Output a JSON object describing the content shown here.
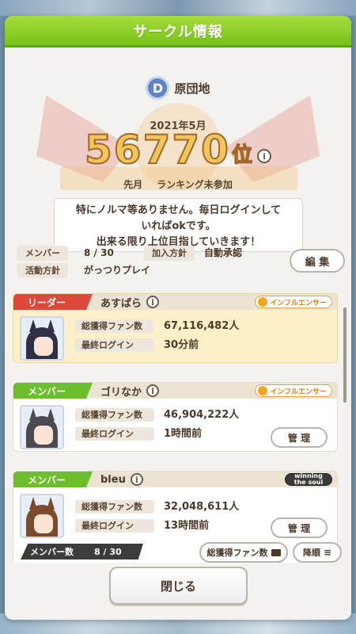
{
  "dialog": {
    "title": "サークル情報"
  },
  "circle": {
    "badge_letter": "D",
    "name": "原団地",
    "date": "2021年5月",
    "rank": "56770",
    "rank_unit": "位",
    "info_glyph": "i",
    "last_month_label": "先月",
    "last_month_value": "ランキング未参加",
    "message": "特にノルマ等ありません。毎日ログインして\nいればokです。\n出来る限り上位目指していきます！",
    "members_label": "メンバー",
    "members_value": "8 / 30",
    "join_label": "加入方針",
    "join_value": "自動承認",
    "activity_label": "活動方針",
    "activity_value": "がっつりプレイ",
    "edit_button": "編 集"
  },
  "members": [
    {
      "role": "リーダー",
      "name": "あすぱら",
      "tag": "インフルエンサー",
      "fans_label": "総獲得ファン数",
      "fans": "67,116,482人",
      "login_label": "最終ログイン",
      "login": "30分前",
      "manage": ""
    },
    {
      "role": "メンバー",
      "name": "ゴリなか",
      "tag": "インフルエンサー",
      "fans_label": "総獲得ファン数",
      "fans": "46,904,222人",
      "login_label": "最終ログイン",
      "login": "1時間前",
      "manage": "管 理"
    },
    {
      "role": "メンバー",
      "name": "bleu",
      "tag": "winning the soul",
      "fans_label": "総獲得ファン数",
      "fans": "32,048,611人",
      "login_label": "最終ログイン",
      "login": "13時間前",
      "manage": "管 理"
    }
  ],
  "footer": {
    "count_label": "メンバー数",
    "count_value": "8 / 30",
    "sort_key": "総獲得ファン数",
    "order": "降順",
    "close": "閉じる"
  },
  "colors": {
    "title_green": "#8fd12a",
    "leader_red": "#e0463a",
    "member_green": "#6cbf2a",
    "rank_gold": "#f2c55c"
  }
}
